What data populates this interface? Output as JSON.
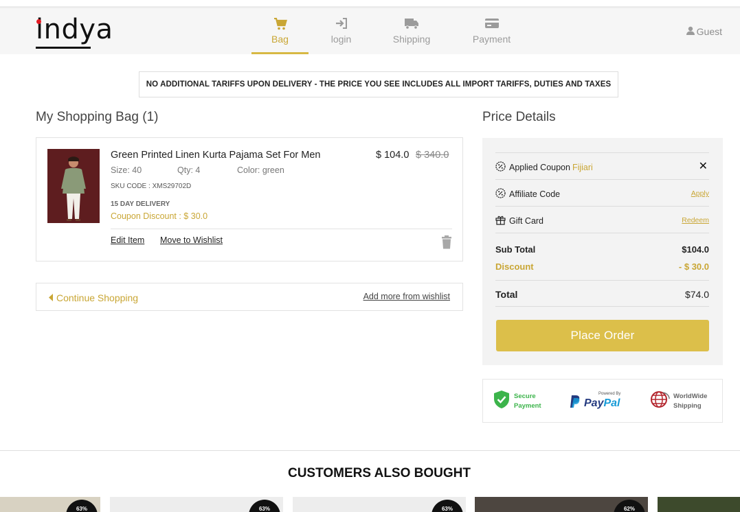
{
  "brand": {
    "logo": "indya"
  },
  "steps": [
    {
      "label": "Bag",
      "icon": "cart-icon",
      "active": true
    },
    {
      "label": "login",
      "icon": "sign-in-icon",
      "active": false
    },
    {
      "label": "Shipping",
      "icon": "truck-icon",
      "active": false
    },
    {
      "label": "Payment",
      "icon": "credit-card-icon",
      "active": false
    }
  ],
  "user": {
    "label": "Guest",
    "icon": "user-icon"
  },
  "notice": "NO ADDITIONAL TARIFFS UPON DELIVERY - THE PRICE YOU SEE INCLUDES ALL IMPORT TARIFFS, DUTIES AND TAXES",
  "bag": {
    "title": "My Shopping Bag (1)",
    "item": {
      "name": "Green Printed Linen Kurta Pajama Set For Men",
      "price": "$ 104.0",
      "old_price": "$ 340.0",
      "size": "Size: 40",
      "qty": "Qty: 4",
      "color": "Color: green",
      "sku": "SKU CODE : XMS29702D",
      "delivery": "15 DAY DELIVERY",
      "coupon": "Coupon Discount : $ 30.0",
      "edit_label": "Edit Item",
      "wishlist_label": "Move to Wishlist"
    },
    "continue_label": "Continue Shopping",
    "add_more_label": "Add more from wishlist"
  },
  "price_details": {
    "title": "Price Details",
    "applied_coupon_label": "Applied Coupon",
    "coupon_code": "Fijiari",
    "affiliate_label": "Affiliate Code",
    "affiliate_action": "Apply",
    "gift_label": "Gift Card",
    "gift_action": "Redeem",
    "subtotal_label": "Sub Total",
    "subtotal_value": "$104.0",
    "discount_label": "Discount",
    "discount_value": "- $ 30.0",
    "total_label": "Total",
    "total_value": "$74.0",
    "place_order_label": "Place Order"
  },
  "badges": {
    "secure_line1": "Secure",
    "secure_line2": "Payment",
    "paypal_small": "Powered By",
    "paypal_pay": "Pay",
    "paypal_pal": "Pal",
    "ship_line1": "WorldWide",
    "ship_line2": "Shipping"
  },
  "also_bought": {
    "title": "CUSTOMERS ALSO BOUGHT",
    "discounts": [
      "63%",
      "63%",
      "63%",
      "62%"
    ]
  },
  "colors": {
    "accent": "#c9a634",
    "button": "#dcbf4a",
    "paypal_dark": "#253b80",
    "paypal_light": "#179bd7",
    "secure_green": "#3cb44b",
    "globe_red": "#b3252d"
  }
}
